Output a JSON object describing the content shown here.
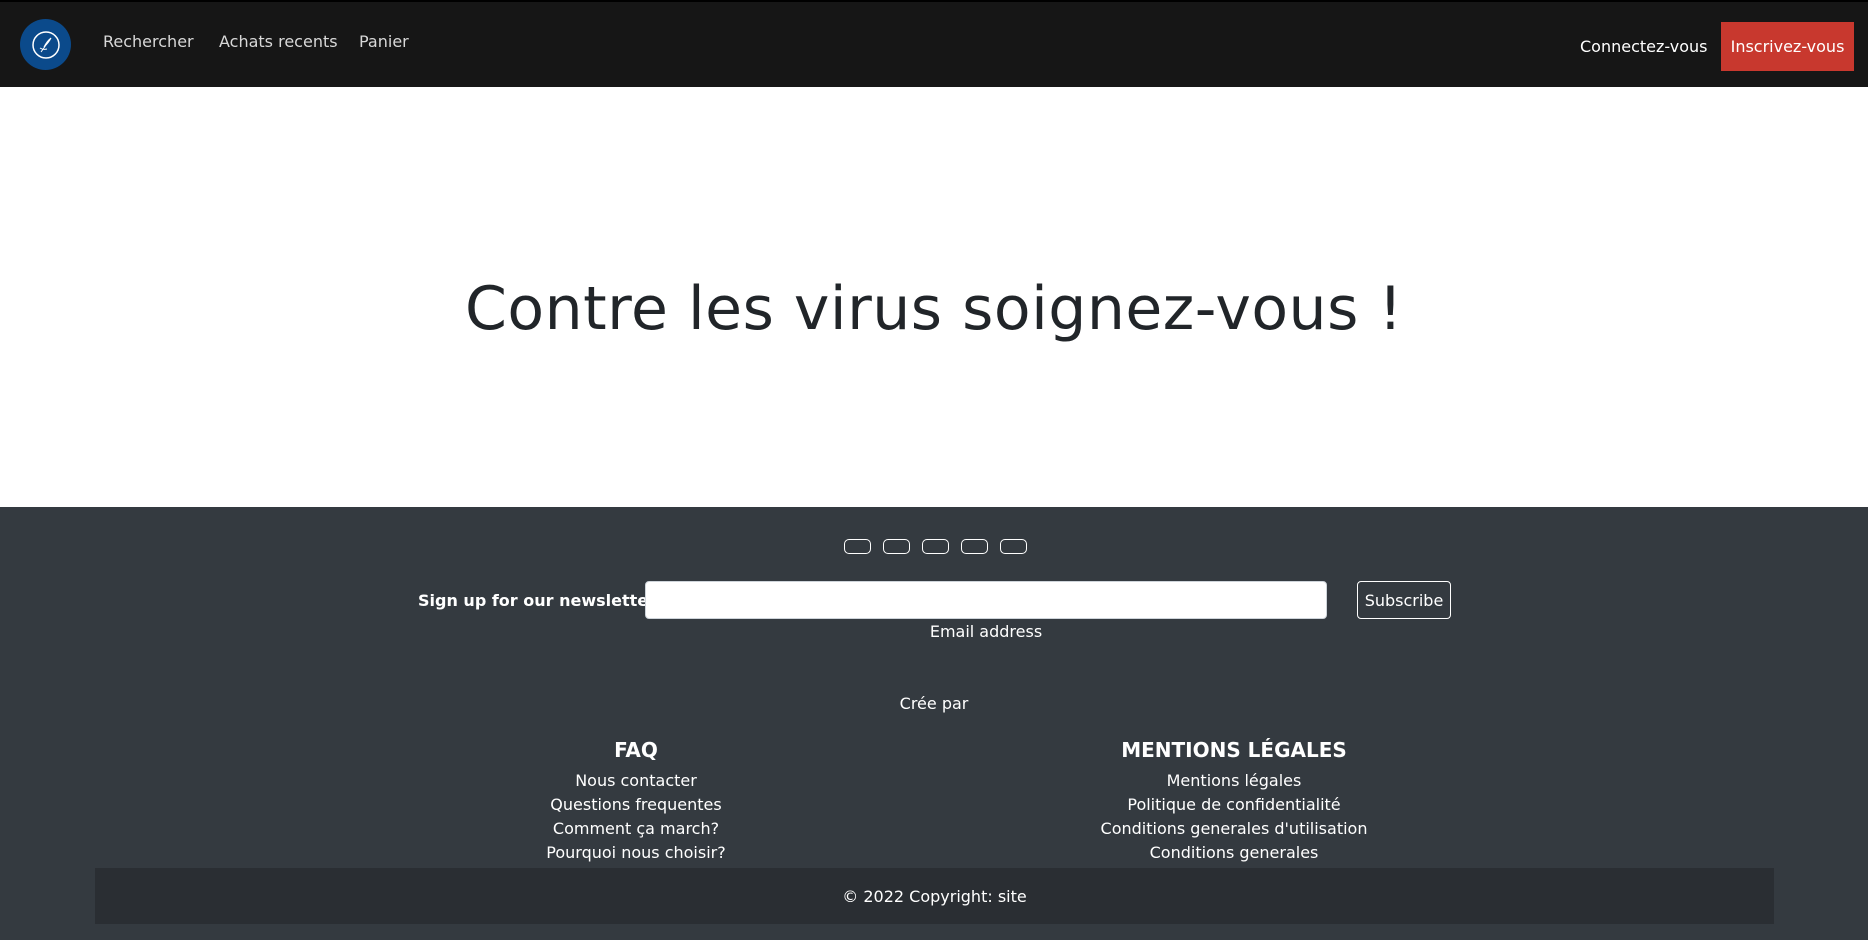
{
  "navbar": {
    "logo_icon": "feather-logo-icon",
    "links": [
      "Rechercher",
      "Achats recents",
      "Panier"
    ],
    "login_label": "Connectez-vous",
    "signup_label": "Inscrivez-vous",
    "colors": {
      "background": "#161616",
      "accent": "#c8382e",
      "logo": "#0b4a8b"
    }
  },
  "hero": {
    "title": "Contre les virus soignez-vous !"
  },
  "footer": {
    "social_icons": [
      "facebook-icon",
      "twitter-icon",
      "google-icon",
      "instagram-icon",
      "linkedin-icon"
    ],
    "newsletter": {
      "label": "Sign up for our newsletter",
      "email_value": "",
      "email_caption": "Email address",
      "subscribe_label": "Subscribe"
    },
    "credit": "Crée par",
    "faq": {
      "title": "FAQ",
      "links": [
        "Nous contacter",
        "Questions frequentes",
        "Comment ça march?",
        "Pourquoi nous choisir?"
      ]
    },
    "legal": {
      "title": "MENTIONS LÉGALES",
      "links": [
        "Mentions légales",
        "Politique de confidentialité",
        "Conditions generales d'utilisation",
        "Conditions generales"
      ]
    },
    "copyright": "© 2022 Copyright: site",
    "colors": {
      "background": "#343a40",
      "copyright_bar": "#2a2e33"
    }
  }
}
